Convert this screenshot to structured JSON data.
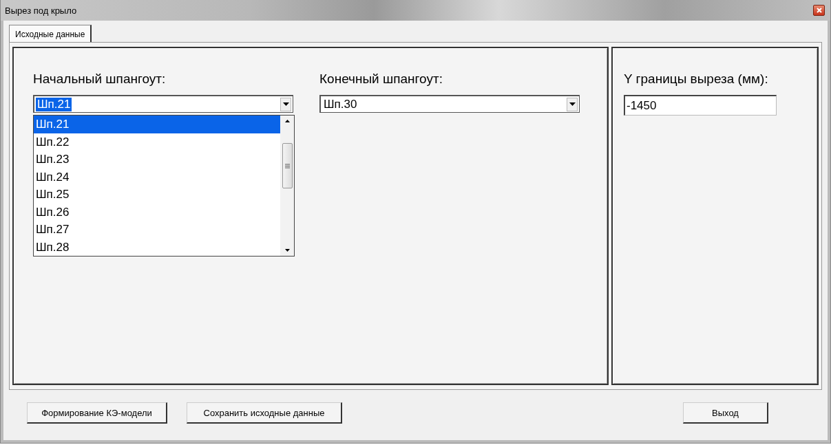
{
  "window": {
    "title": "Вырез под крыло"
  },
  "tabs": [
    {
      "label": "Исходные данные",
      "selected": true
    }
  ],
  "start_frame": {
    "label": "Начальный шпангоут:",
    "value": "Шп.21",
    "focused": true,
    "expanded": true,
    "options": [
      {
        "label": "Шп.21",
        "selected": true
      },
      {
        "label": "Шп.22",
        "selected": false
      },
      {
        "label": "Шп.23",
        "selected": false
      },
      {
        "label": "Шп.24",
        "selected": false
      },
      {
        "label": "Шп.25",
        "selected": false
      },
      {
        "label": "Шп.26",
        "selected": false
      },
      {
        "label": "Шп.27",
        "selected": false
      },
      {
        "label": "Шп.28",
        "selected": false
      }
    ]
  },
  "end_frame": {
    "label": "Конечный шпангоут:",
    "value": "Шп.30",
    "focused": false
  },
  "cut_boundary": {
    "label": "Y границы выреза (мм):",
    "value": "-1450"
  },
  "buttons": [
    {
      "label": "Формирование КЭ-модели",
      "kind": "left"
    },
    {
      "label": "Сохранить исходные данные",
      "kind": "left"
    },
    {
      "label": "Выход",
      "kind": "right"
    }
  ]
}
